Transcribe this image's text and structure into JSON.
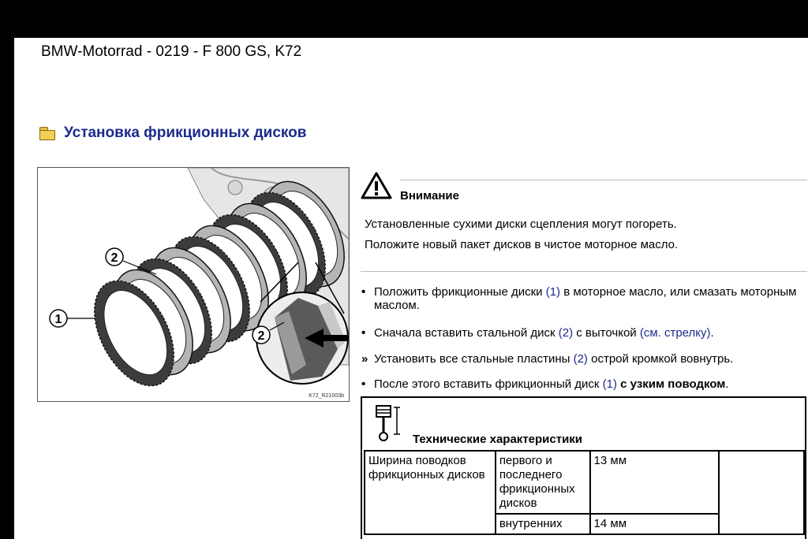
{
  "header": {
    "title": "BMW-Motorrad - 0219 - F 800 GS, K72"
  },
  "section": {
    "title": "Установка фрикционных дисков",
    "icon": "folder-icon"
  },
  "figure": {
    "caption": "K72_R21003b",
    "callout_1": "1",
    "callout_2": "2",
    "callout_2_detail": "2"
  },
  "warning": {
    "title": "Внимание",
    "line1": "Установленные сухими диски сцепления могут погореть.",
    "line2": "Положите новый пакет дисков в чистое моторное масло.",
    "icon": "warning-triangle-icon"
  },
  "steps": [
    {
      "marker": "•",
      "pre": "Положить фрикционные диски ",
      "ref": "(1)",
      "post": " в моторное масло, или смазать моторным маслом."
    },
    {
      "marker": "•",
      "pre": "Сначала вставить стальной диск ",
      "ref": "(2)",
      "mid": " с выточкой ",
      "ref2": "(см. стрелку)",
      "post": "."
    },
    {
      "marker": "»",
      "pre": "Установить все стальные пластины ",
      "ref": "(2)",
      "post": " острой кромкой вовнутрь."
    },
    {
      "marker": "•",
      "pre": "После этого вставить фрикционный диск ",
      "ref": "(1)",
      "mid": " ",
      "bold": "с узким поводком",
      "post": "."
    }
  ],
  "specs": {
    "title": "Технические характеристики",
    "icon": "piston-measure-icon",
    "row1": {
      "label": "Ширина поводков фрикционных дисков",
      "sub": "первого и последнего фрикционных дисков",
      "value": "13 мм"
    },
    "row2": {
      "sub": "внутренних",
      "value": "14 мм"
    }
  }
}
